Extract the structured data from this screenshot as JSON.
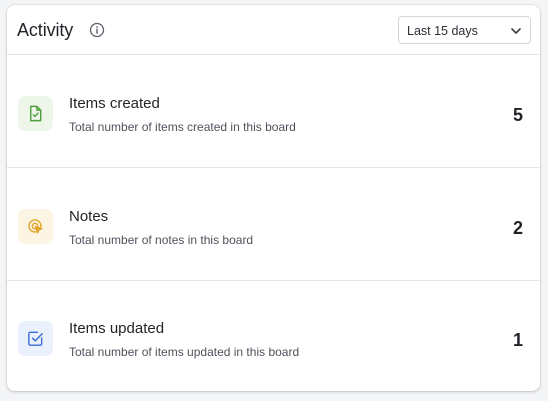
{
  "header": {
    "title": "Activity",
    "info_icon": "info-circle-icon",
    "range_select": {
      "selected": "Last 15 days",
      "icon": "chevron-down-icon"
    }
  },
  "rows": [
    {
      "title": "Items created",
      "description": "Total number of items created in this board",
      "count": "5",
      "icon": "file-check-icon",
      "accent": "#4f9f3d",
      "icon_bg": "#eef6ea"
    },
    {
      "title": "Notes",
      "description": "Total number of notes in this board",
      "count": "2",
      "icon": "target-cursor-icon",
      "accent": "#e0a52a",
      "icon_bg": "#fdf5e3"
    },
    {
      "title": "Items updated",
      "description": "Total number of items updated in this board",
      "count": "1",
      "icon": "checkbox-icon",
      "accent": "#3b6fd4",
      "icon_bg": "#ebf1fc"
    }
  ]
}
